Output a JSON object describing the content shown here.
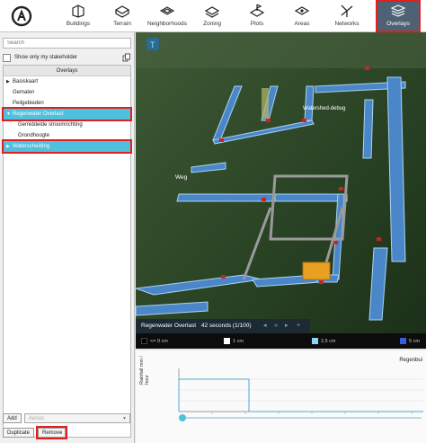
{
  "toolbar": {
    "items": [
      {
        "label": "Buildings",
        "icon": "building-icon"
      },
      {
        "label": "Terrain",
        "icon": "terrain-icon"
      },
      {
        "label": "Neighborhoods",
        "icon": "neighborhoods-icon"
      },
      {
        "label": "Zoning",
        "icon": "zoning-icon"
      },
      {
        "label": "Plots",
        "icon": "plots-icon"
      },
      {
        "label": "Areas",
        "icon": "areas-icon"
      },
      {
        "label": "Networks",
        "icon": "networks-icon"
      },
      {
        "label": "Overlays",
        "icon": "overlays-icon",
        "active": true
      }
    ]
  },
  "left": {
    "search_placeholder": "Search",
    "stakeholder_label": "Show only my stakeholder",
    "tree_header": "Overlays",
    "items": [
      {
        "label": "Basiskaart",
        "level": 0,
        "arrow": "▶"
      },
      {
        "label": "Gemalen",
        "level": 0
      },
      {
        "label": "Peilgebieden",
        "level": 0
      },
      {
        "label": "Regenwater Overlast",
        "level": 0,
        "arrow": "▼",
        "selected": true
      },
      {
        "label": "Gemiddelde stroomrichting",
        "level": 1
      },
      {
        "label": "Grondhoogte",
        "level": 1
      },
      {
        "label": "Waterscheiding",
        "level": 0,
        "arrow": "▶",
        "selected": true
      }
    ],
    "add_label": "Add",
    "dropdown_value": "Aerius",
    "duplicate_label": "Duplicate",
    "remove_label": "Remove"
  },
  "viewport": {
    "labels": {
      "watershed": "Watershed-debug",
      "weg": "Weg"
    }
  },
  "status": {
    "name": "Regenwater Overlast",
    "time": "42 seconds (1/100)"
  },
  "legend": {
    "entries": [
      {
        "label": "<= 0 cm",
        "color": "#000000"
      },
      {
        "label": "1 cm",
        "color": "#ffffff"
      },
      {
        "label": "2,5 cm",
        "color": "#8fd3f4"
      },
      {
        "label": "5 cm",
        "color": "#3b5bdb"
      }
    ]
  },
  "graph": {
    "title": "Regenbui",
    "ylabel": "Rainfall mm / hour"
  },
  "colors": {
    "accent": "#4fc0dd",
    "highlight": "#e02020",
    "active_tab": "#4f6275"
  }
}
